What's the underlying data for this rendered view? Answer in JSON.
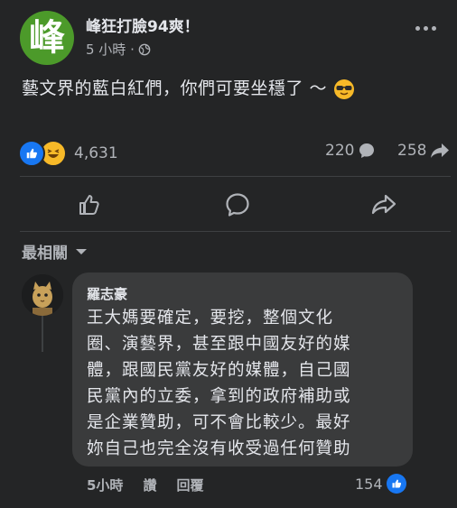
{
  "post": {
    "page_name": "峰狂打臉94爽！",
    "avatar_char": "峰",
    "time": "5 小時 · ",
    "text": "藝文界的藍白紅們，你們可要坐穩了 ～",
    "reactions_count": "4,631",
    "comments_count": "220",
    "shares_count": "258",
    "avatar_color": "#4c9a2a"
  },
  "sort_label": "最相關",
  "comment": {
    "author": "羅志豪",
    "lines": [
      "王大媽要確定，要挖，整個文化",
      "圈、演藝界，甚至跟中國友好的媒",
      "體，跟國民黨友好的媒體，自己國",
      "民黨內的立委，拿到的政府補助或",
      "是企業贊助，可不會比較少。最好",
      "妳自己也完全沒有收受過任何贊助"
    ],
    "time": "5小時",
    "like_label": "讚",
    "reply_label": "回覆",
    "likes": "154"
  },
  "icons": {
    "like": "thumbs-up-icon",
    "comment": "comment-icon",
    "share": "share-icon",
    "globe": "globe-icon",
    "more": "more-icon",
    "dropdown": "caret-down-icon",
    "sunglasses": "sunglasses-emoji-icon",
    "haha": "haha-reaction-icon"
  },
  "colors": {
    "background": "#242526",
    "bubble": "#3a3b3c",
    "accent": "#1877f2",
    "secondary_text": "#b0b3b8"
  }
}
